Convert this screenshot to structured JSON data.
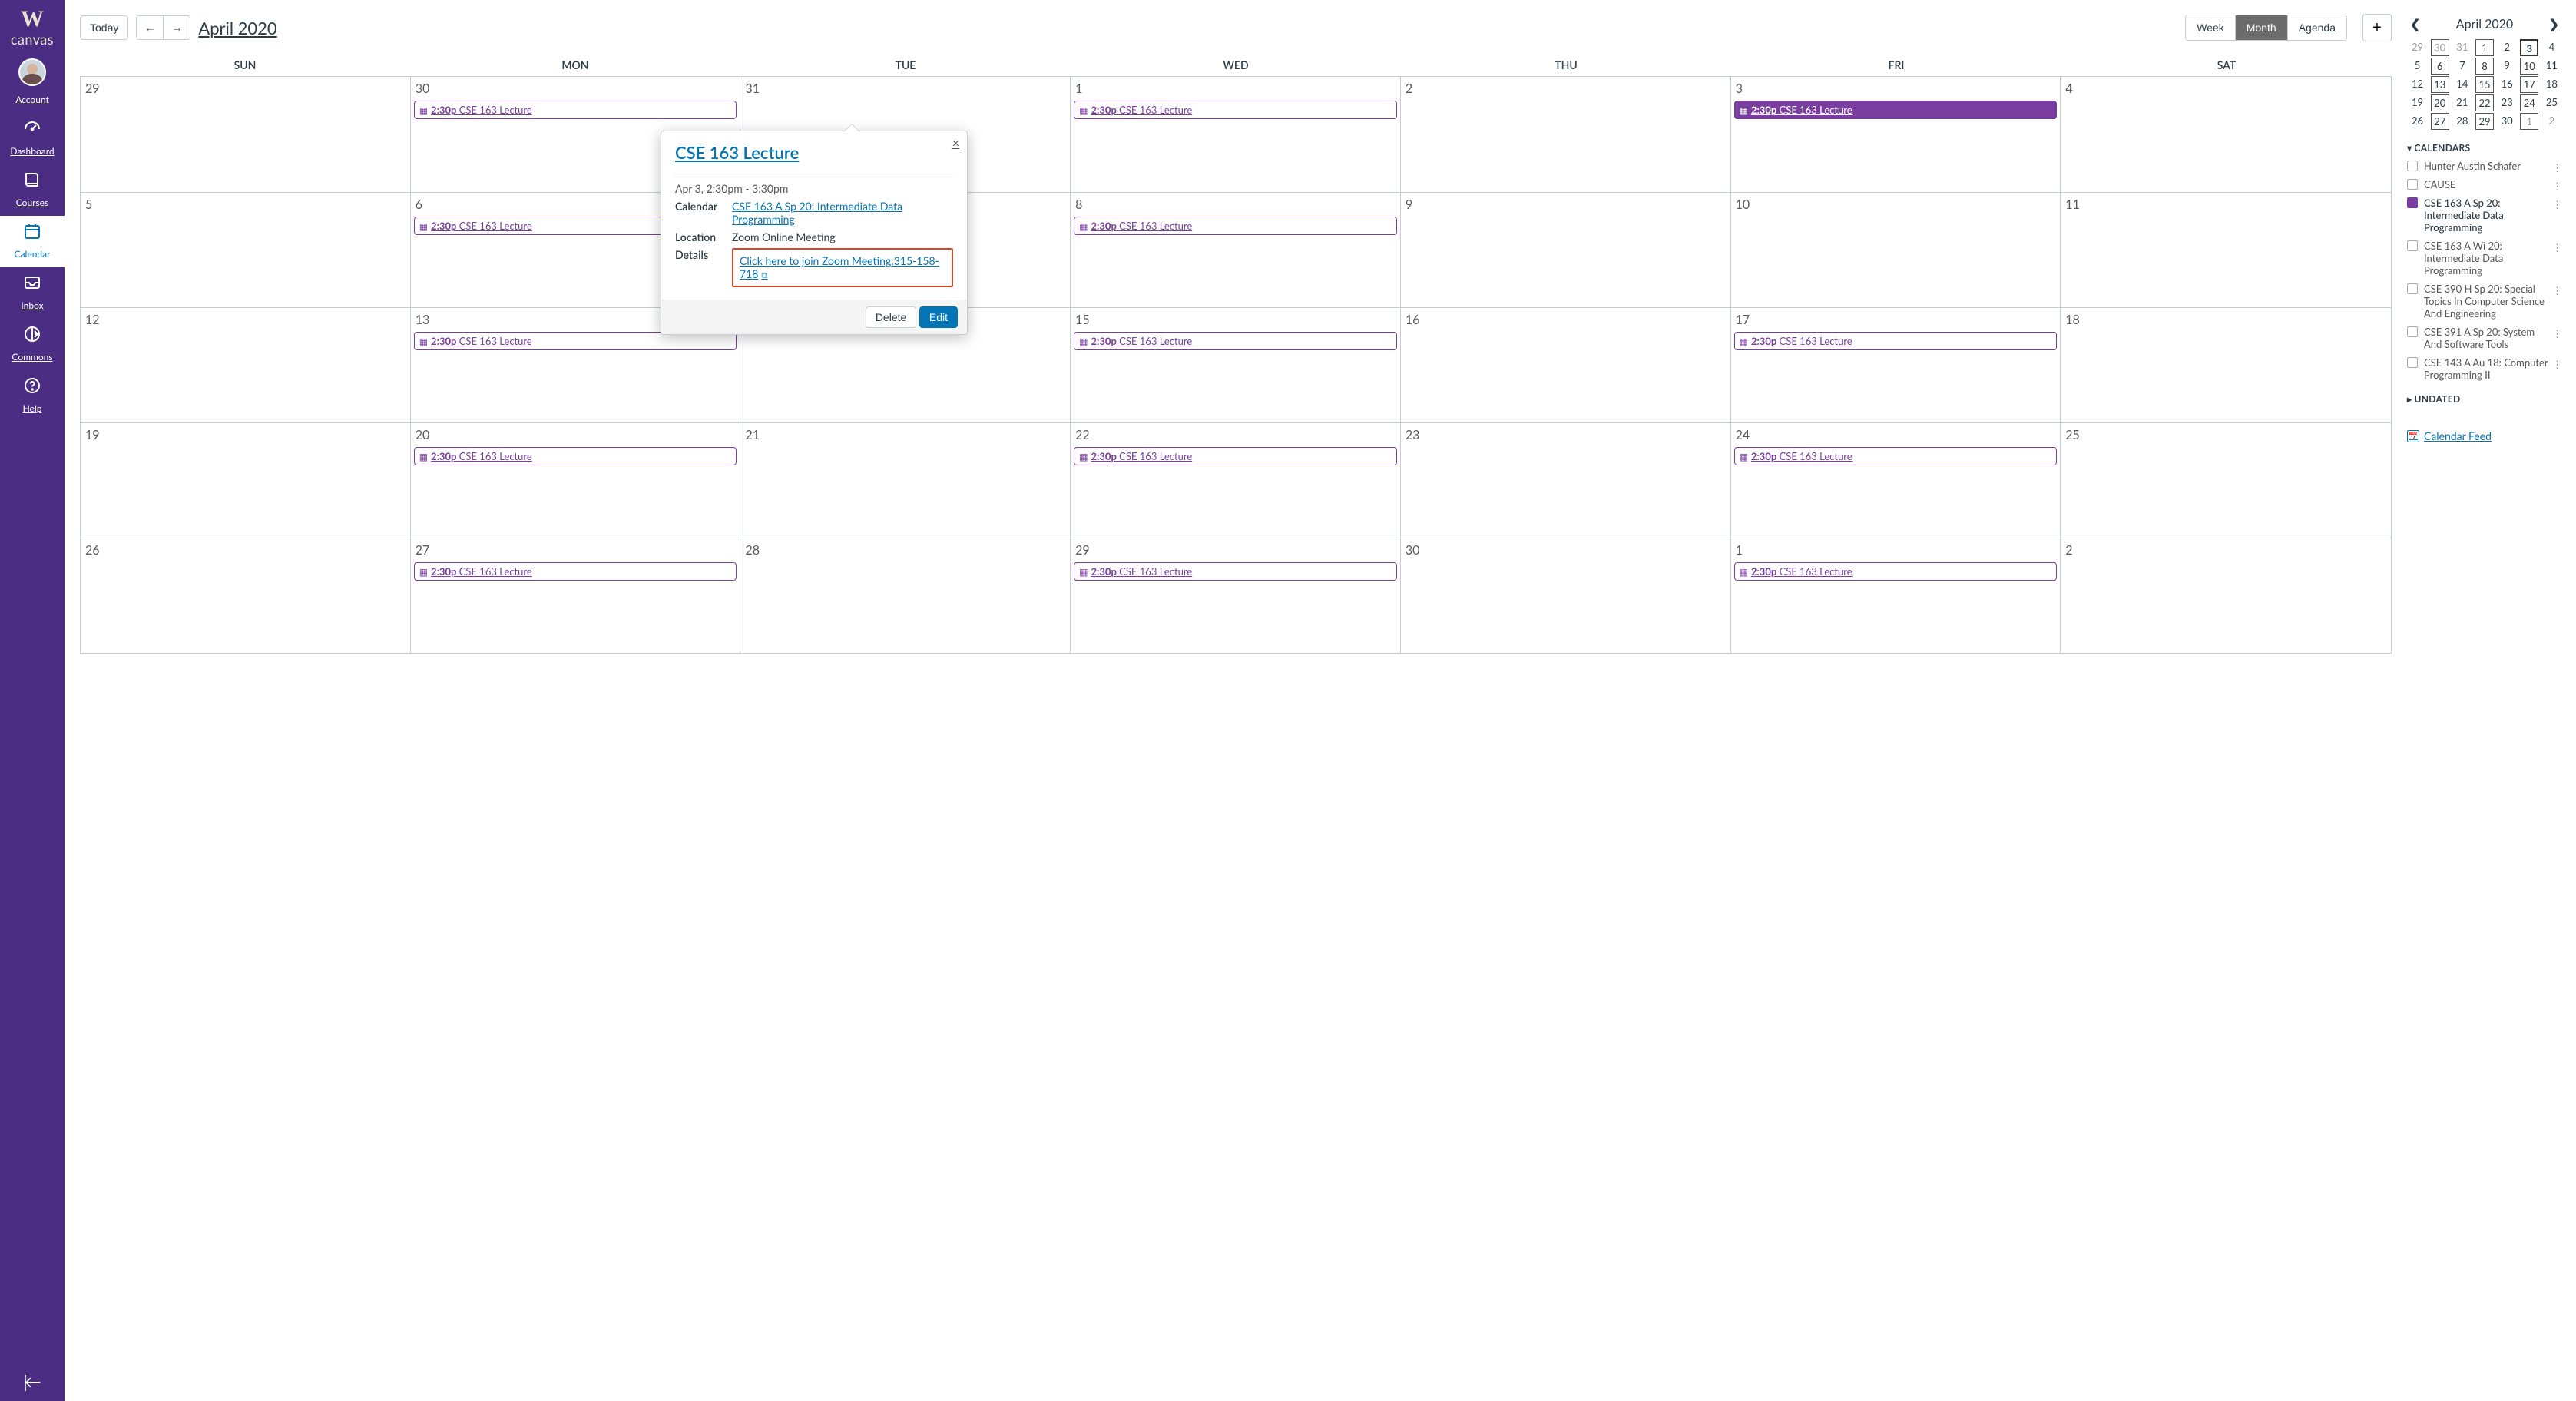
{
  "brand": {
    "initial": "W",
    "name": "canvas"
  },
  "nav": {
    "account": "Account",
    "dashboard": "Dashboard",
    "courses": "Courses",
    "calendar": "Calendar",
    "inbox": "Inbox",
    "commons": "Commons",
    "help": "Help"
  },
  "header": {
    "today": "Today",
    "title": "April 2020",
    "views": {
      "week": "Week",
      "month": "Month",
      "agenda": "Agenda"
    }
  },
  "dow": [
    "SUN",
    "MON",
    "TUE",
    "WED",
    "THU",
    "FRI",
    "SAT"
  ],
  "weeks": [
    [
      {
        "n": "29"
      },
      {
        "n": "30",
        "ev": "2:30p CSE 163 Lecture"
      },
      {
        "n": "31"
      },
      {
        "n": "1",
        "ev": "2:30p CSE 163 Lecture"
      },
      {
        "n": "2"
      },
      {
        "n": "3",
        "ev": "2:30p CSE 163 Lecture",
        "selected": true
      },
      {
        "n": "4"
      }
    ],
    [
      {
        "n": "5"
      },
      {
        "n": "6",
        "ev": "2:30p CSE 163 Lecture"
      },
      {
        "n": "7"
      },
      {
        "n": "8",
        "ev": "2:30p CSE 163 Lecture"
      },
      {
        "n": "9"
      },
      {
        "n": "10"
      },
      {
        "n": "11"
      }
    ],
    [
      {
        "n": "12"
      },
      {
        "n": "13",
        "ev": "2:30p CSE 163 Lecture"
      },
      {
        "n": "14"
      },
      {
        "n": "15",
        "ev": "2:30p CSE 163 Lecture"
      },
      {
        "n": "16"
      },
      {
        "n": "17",
        "ev": "2:30p CSE 163 Lecture"
      },
      {
        "n": "18"
      }
    ],
    [
      {
        "n": "19"
      },
      {
        "n": "20",
        "ev": "2:30p CSE 163 Lecture"
      },
      {
        "n": "21"
      },
      {
        "n": "22",
        "ev": "2:30p CSE 163 Lecture"
      },
      {
        "n": "23"
      },
      {
        "n": "24",
        "ev": "2:30p CSE 163 Lecture"
      },
      {
        "n": "25"
      }
    ],
    [
      {
        "n": "26"
      },
      {
        "n": "27",
        "ev": "2:30p CSE 163 Lecture"
      },
      {
        "n": "28"
      },
      {
        "n": "29",
        "ev": "2:30p CSE 163 Lecture"
      },
      {
        "n": "30"
      },
      {
        "n": "1",
        "ev": "2:30p CSE 163 Lecture"
      },
      {
        "n": "2"
      }
    ]
  ],
  "popover": {
    "title": "CSE 163 Lecture",
    "time": "Apr 3, 2:30pm - 3:30pm",
    "calendar_label": "Calendar",
    "calendar_value": "CSE 163 A Sp 20: Intermediate Data Programming",
    "location_label": "Location",
    "location_value": "Zoom Online Meeting",
    "details_label": "Details",
    "details_link": "Click here to join Zoom Meeting:315-158-718",
    "delete": "Delete",
    "edit": "Edit",
    "close": "×"
  },
  "mini": {
    "title": "April 2020",
    "rows": [
      [
        {
          "n": "29",
          "muted": true
        },
        {
          "n": "30",
          "muted": true,
          "boxed": true
        },
        {
          "n": "31",
          "muted": true
        },
        {
          "n": "1",
          "boxed": true
        },
        {
          "n": "2"
        },
        {
          "n": "3",
          "boxed": true,
          "bold": true
        },
        {
          "n": "4"
        }
      ],
      [
        {
          "n": "5"
        },
        {
          "n": "6",
          "boxed": true
        },
        {
          "n": "7"
        },
        {
          "n": "8",
          "boxed": true
        },
        {
          "n": "9"
        },
        {
          "n": "10",
          "boxed": true
        },
        {
          "n": "11"
        }
      ],
      [
        {
          "n": "12"
        },
        {
          "n": "13",
          "boxed": true
        },
        {
          "n": "14"
        },
        {
          "n": "15",
          "boxed": true
        },
        {
          "n": "16"
        },
        {
          "n": "17",
          "boxed": true
        },
        {
          "n": "18"
        }
      ],
      [
        {
          "n": "19"
        },
        {
          "n": "20",
          "boxed": true
        },
        {
          "n": "21"
        },
        {
          "n": "22",
          "boxed": true
        },
        {
          "n": "23"
        },
        {
          "n": "24",
          "boxed": true
        },
        {
          "n": "25"
        }
      ],
      [
        {
          "n": "26"
        },
        {
          "n": "27",
          "boxed": true
        },
        {
          "n": "28"
        },
        {
          "n": "29",
          "boxed": true
        },
        {
          "n": "30"
        },
        {
          "n": "1",
          "muted": true,
          "boxed": true
        },
        {
          "n": "2",
          "muted": true
        }
      ]
    ]
  },
  "calendars_header": "CALENDARS",
  "calendars": [
    {
      "name": "Hunter Austin Schafer"
    },
    {
      "name": "CAUSE"
    },
    {
      "name": "CSE 163 A Sp 20: Intermediate Data Programming",
      "active": true
    },
    {
      "name": "CSE 163 A Wi 20: Intermediate Data Programming"
    },
    {
      "name": "CSE 390 H Sp 20: Special Topics In Computer Science And Engineering"
    },
    {
      "name": "CSE 391 A Sp 20: System And Software Tools"
    },
    {
      "name": "CSE 143 A Au 18: Computer Programming II"
    }
  ],
  "undated_header": "UNDATED",
  "feed_link": "Calendar Feed"
}
